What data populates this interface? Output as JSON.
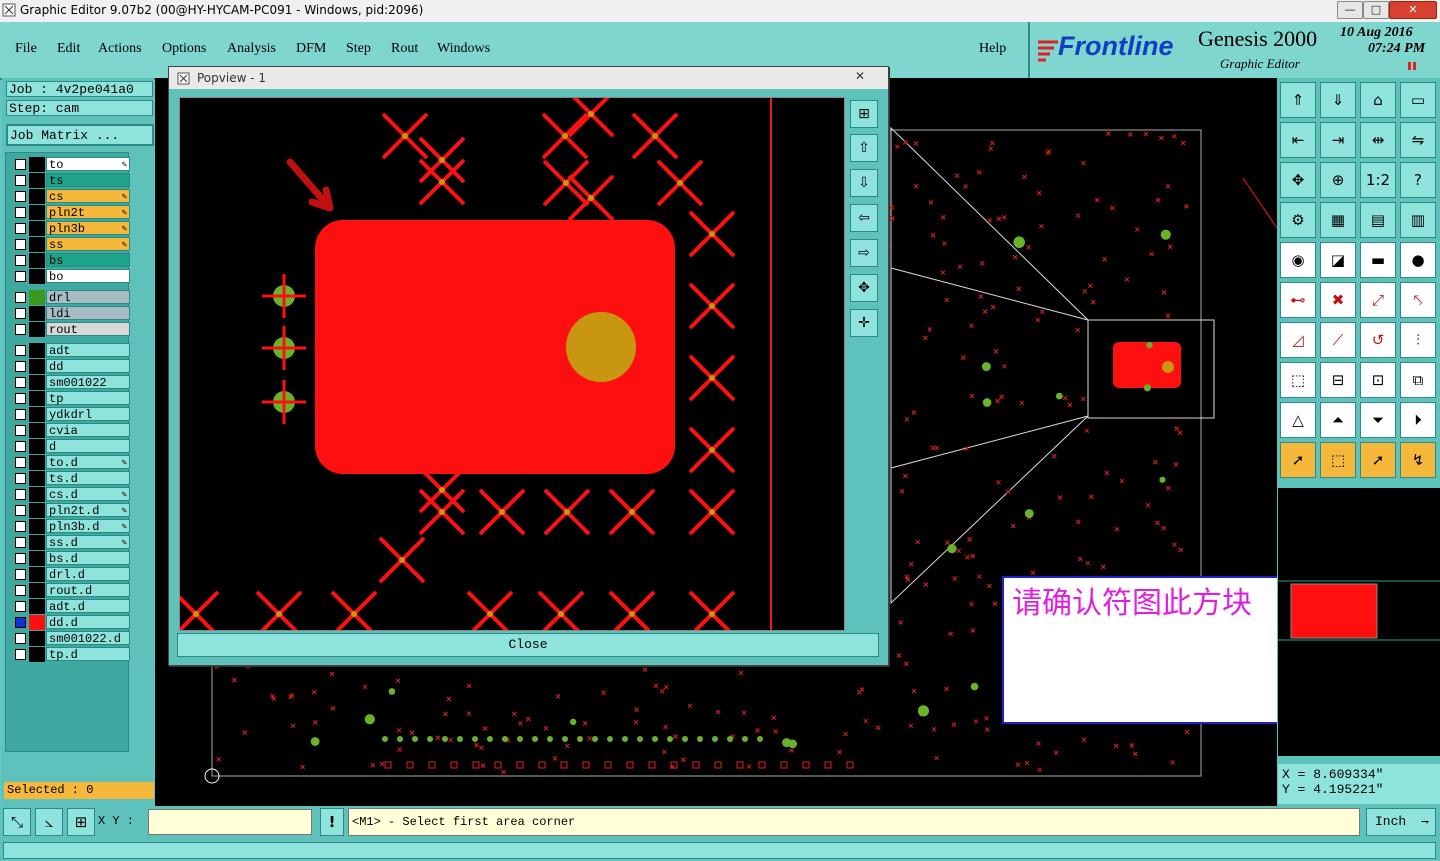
{
  "window": {
    "title": "Graphic Editor 9.07b2 (00@HY-HYCAM-PC091 - Windows, pid:2096)",
    "min_label": "—",
    "max_label": "□",
    "close_label": "✕"
  },
  "menu": [
    "File",
    "Edit",
    "Actions",
    "Options",
    "Analysis",
    "DFM",
    "Step",
    "Rout",
    "Windows"
  ],
  "help_label": "Help",
  "logo": {
    "brand": "Frontline",
    "product": "Genesis 2000",
    "subtitle": "Graphic Editor",
    "date": "10 Aug 2016",
    "time": "07:24 PM"
  },
  "job": {
    "job_label": "Job : 4v2pe041a0",
    "step_label": "Step: cam",
    "matrix_button": "Job Matrix ..."
  },
  "layers": [
    {
      "name": "to",
      "color": "#ffffff",
      "edit": true
    },
    {
      "name": "ts",
      "color": "#1fa388",
      "edit": false
    },
    {
      "name": "cs",
      "color": "#f5b83a",
      "edit": true
    },
    {
      "name": "pln2t",
      "color": "#f5b83a",
      "edit": true
    },
    {
      "name": "pln3b",
      "color": "#f5b83a",
      "edit": true
    },
    {
      "name": "ss",
      "color": "#f5b83a",
      "edit": true
    },
    {
      "name": "bs",
      "color": "#1fa388",
      "edit": false
    },
    {
      "name": "bo",
      "color": "#ffffff",
      "edit": false
    },
    {
      "name": "drl",
      "color": "#a8bcc4",
      "edit": false
    },
    {
      "name": "ldi",
      "color": "#a8bcc4",
      "edit": false
    },
    {
      "name": "rout",
      "color": "#d8d8d8",
      "edit": false
    },
    {
      "name": "adt",
      "color": "#8ee4dc",
      "edit": false
    },
    {
      "name": "dd",
      "color": "#8ee4dc",
      "edit": false
    },
    {
      "name": "sm001022",
      "color": "#8ee4dc",
      "edit": false
    },
    {
      "name": "tp",
      "color": "#8ee4dc",
      "edit": false
    },
    {
      "name": "ydkdrl",
      "color": "#8ee4dc",
      "edit": false
    },
    {
      "name": "cvia",
      "color": "#8ee4dc",
      "edit": false
    },
    {
      "name": "d",
      "color": "#8ee4dc",
      "edit": false
    },
    {
      "name": "to.d",
      "color": "#8ee4dc",
      "edit": true
    },
    {
      "name": "ts.d",
      "color": "#8ee4dc",
      "edit": false
    },
    {
      "name": "cs.d",
      "color": "#8ee4dc",
      "edit": true
    },
    {
      "name": "pln2t.d",
      "color": "#8ee4dc",
      "edit": true
    },
    {
      "name": "pln3b.d",
      "color": "#8ee4dc",
      "edit": true
    },
    {
      "name": "ss.d",
      "color": "#8ee4dc",
      "edit": true
    },
    {
      "name": "bs.d",
      "color": "#8ee4dc",
      "edit": false
    },
    {
      "name": "drl.d",
      "color": "#8ee4dc",
      "edit": false
    },
    {
      "name": "rout.d",
      "color": "#8ee4dc",
      "edit": false
    },
    {
      "name": "adt.d",
      "color": "#8ee4dc",
      "edit": false
    },
    {
      "name": "dd.d",
      "color": "#8ee4dc",
      "edit": false,
      "active": true
    },
    {
      "name": "sm001022.d",
      "color": "#8ee4dc",
      "edit": false
    },
    {
      "name": "tp.d",
      "color": "#8ee4dc",
      "edit": false
    }
  ],
  "selected_label": "Selected : 0",
  "popview": {
    "title": "Popview - 1",
    "close_x": "✕",
    "close_button": "Close"
  },
  "message": "请确认符图此方块",
  "coords": {
    "x": "X = 8.609334\"",
    "y": "Y = 4.195221\""
  },
  "bottom": {
    "xy_label": "X Y :",
    "xy_value": "",
    "prompt": "<M1> - Select first area corner",
    "unit": "Inch"
  },
  "colors": {
    "panel": "#5ec2ba",
    "button": "#8ee4dc",
    "feature": "#ff1010",
    "pad": "#c89610",
    "green": "#6ab22a"
  }
}
